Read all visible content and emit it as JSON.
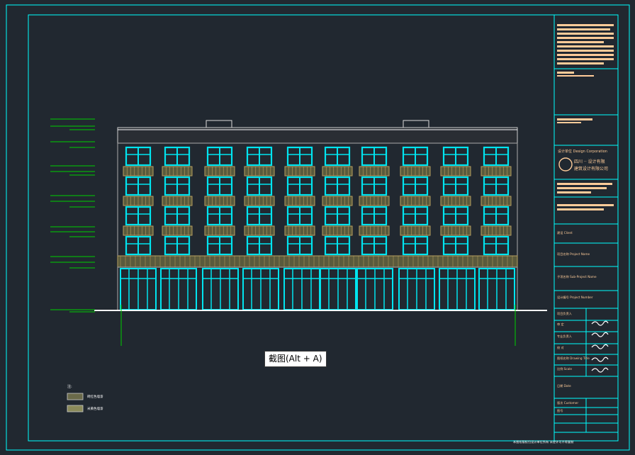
{
  "tooltip": {
    "label": "截图(Alt + A)"
  },
  "colors": {
    "background": "#212830",
    "frame": "#00ffff",
    "inner_frame": "#00ffff",
    "glazing": "#00e5f0",
    "railing": "#b8a060",
    "railing_fill": "#5a5a3c",
    "dim_lines": "#00d000",
    "title_block_text": "#ffcc99",
    "ground": "#ffffff"
  },
  "legend": {
    "title": "注:",
    "items": [
      {
        "swatch_color": "#6a6a4a",
        "label": "砖红色墙漆"
      },
      {
        "swatch_color": "#8a8a5a",
        "label": "米黄色墙漆"
      }
    ]
  },
  "title_block": {
    "design_label": "设计单位 Design Corporation",
    "company_line1": "四川 ·· 设计有限",
    "company_line2": "建筑设计有限公司",
    "fields": [
      {
        "label": "建设 Client",
        "value": ""
      },
      {
        "label": "项目名称 Project Name",
        "value": ""
      },
      {
        "label": "子项名称 Sub-Project Name",
        "value": ""
      },
      {
        "label": "设计编号 Project Number",
        "value": ""
      },
      {
        "label": "项目负责人",
        "value": ""
      },
      {
        "label": "审 定",
        "value": ""
      },
      {
        "label": "专业负责人",
        "value": ""
      },
      {
        "label": "校 对",
        "value": ""
      },
      {
        "label": "图纸名称 Drawing Title",
        "value": ""
      },
      {
        "label": "比例 Scale",
        "value": ""
      },
      {
        "label": "日期 Date",
        "value": ""
      },
      {
        "label": "版次 Customer",
        "value": ""
      },
      {
        "label": "图号",
        "value": ""
      }
    ]
  },
  "footer": {
    "note": "本图纸版权归设计单位所有 未经许可不得复制"
  }
}
